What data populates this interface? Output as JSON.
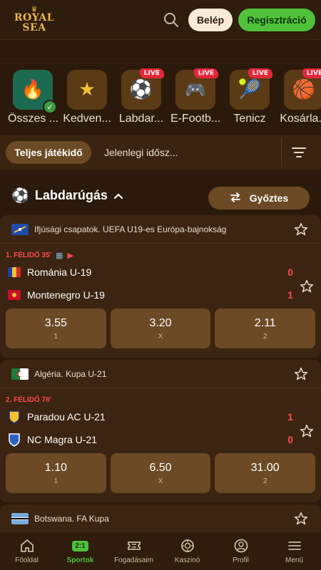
{
  "header": {
    "logo_line1": "ROYAL",
    "logo_line2": "SEA",
    "login_label": "Belép",
    "register_label": "Regisztráció"
  },
  "sports": [
    {
      "name": "Összes ...",
      "icon": "fire-icon",
      "live": "",
      "active": true
    },
    {
      "name": "Kedven...",
      "icon": "star-icon",
      "live": ""
    },
    {
      "name": "Labdar...",
      "icon": "soccer-ball-icon",
      "live": "LIVE"
    },
    {
      "name": "E-Footb...",
      "icon": "gamepad-icon",
      "live": "LIVE"
    },
    {
      "name": "Tenicz",
      "icon": "tennis-ball-icon",
      "live": "LIVE"
    },
    {
      "name": "Kosárla...",
      "icon": "basketball-icon",
      "live": "LIVE"
    }
  ],
  "filters": {
    "active": "Teljes játékidő",
    "other": "Jelenlegi idősz..."
  },
  "section": {
    "title": "Labdarúgás",
    "winner_label": "Győztes"
  },
  "matches": [
    {
      "competition": "Ifjúsági csapatok. UEFA U19-es Európa-bajnokság",
      "period": "1. FÉLIDŐ 35'",
      "team1": "Románia U-19",
      "team2": "Montenegro U-19",
      "score1": "0",
      "score2": "1",
      "odds": [
        {
          "value": "3.55",
          "key": "1"
        },
        {
          "value": "3.20",
          "key": "X"
        },
        {
          "value": "2.11",
          "key": "2"
        }
      ]
    },
    {
      "competition": "Algéria. Kupa U-21",
      "period": "2. FÉLIDŐ 76'",
      "team1": "Paradou AC U-21",
      "team2": "NC Magra U-21",
      "score1": "1",
      "score2": "0",
      "odds": [
        {
          "value": "1.10",
          "key": "1"
        },
        {
          "value": "6.50",
          "key": "X"
        },
        {
          "value": "31.00",
          "key": "2"
        }
      ]
    },
    {
      "competition": "Botswana. FA Kupa"
    }
  ],
  "nav": [
    {
      "label": "Főoldal",
      "icon": "home-icon"
    },
    {
      "label": "Sportok",
      "icon": "sports-icon",
      "badge": "2:1",
      "active": true
    },
    {
      "label": "Fogadásaim",
      "icon": "ticket-icon"
    },
    {
      "label": "Kaszinó",
      "icon": "casino-chip-icon"
    },
    {
      "label": "Profil",
      "icon": "profile-icon"
    },
    {
      "label": "Menü",
      "icon": "menu-icon"
    }
  ],
  "colors": {
    "background": "#2b1a0b",
    "card": "#3b2411",
    "odd_button": "#6b4a25",
    "accent_green": "#4fc23a",
    "live_red": "#e5273a",
    "brand_gold": "#e8b64a"
  }
}
